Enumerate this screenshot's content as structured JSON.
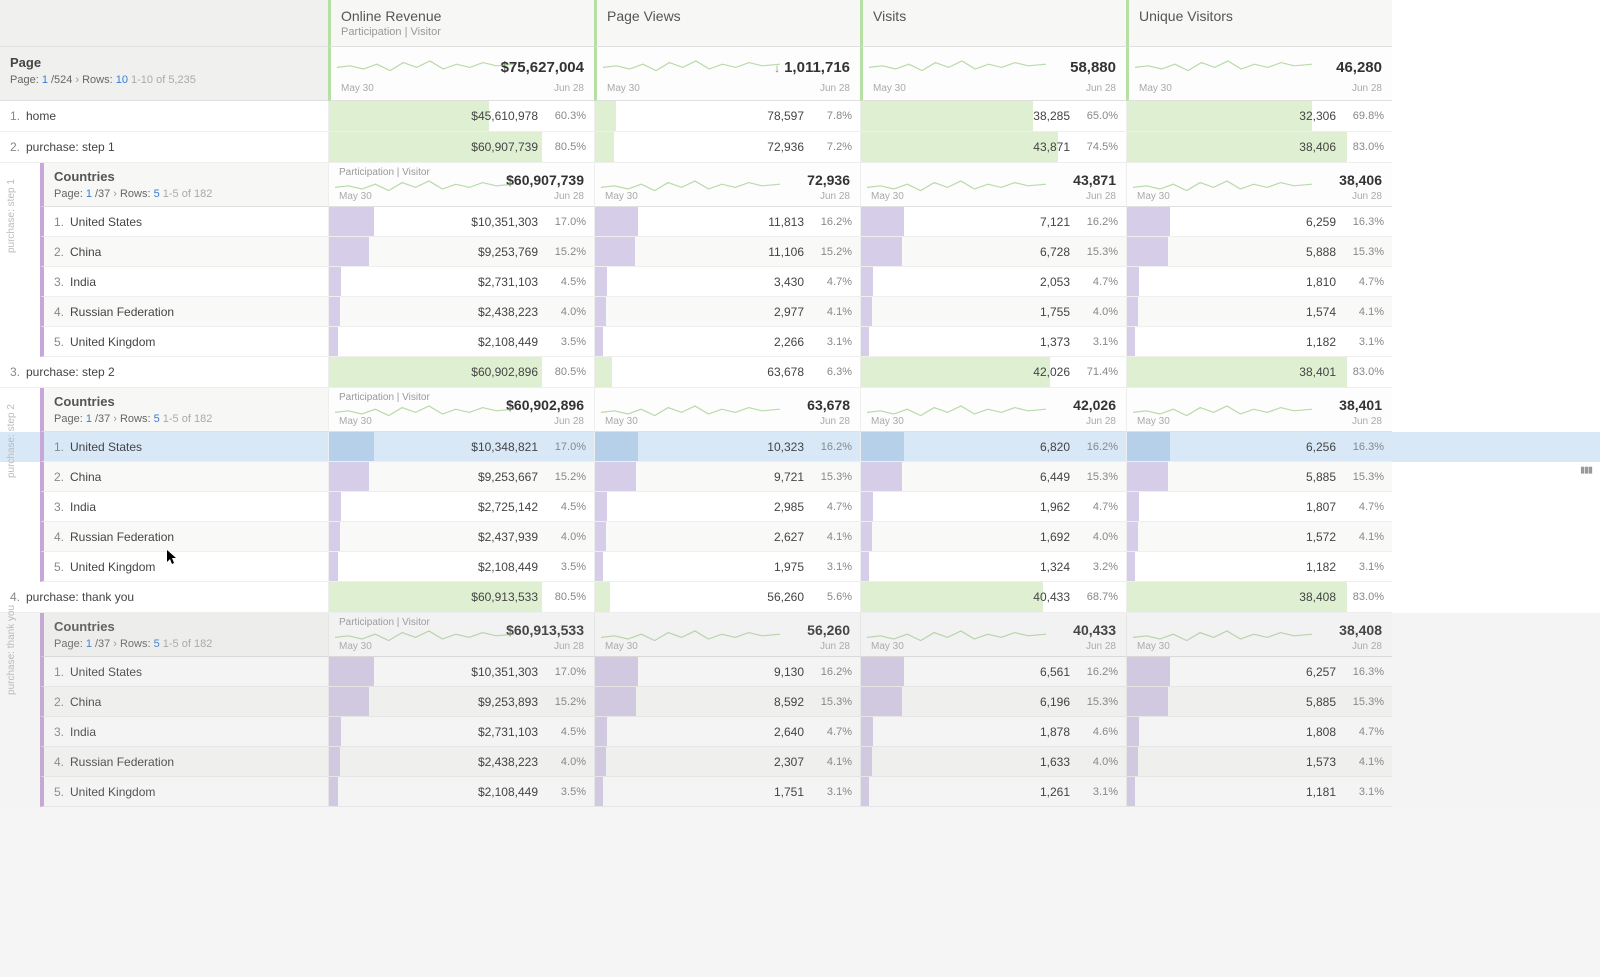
{
  "dateRange": {
    "start": "May 30",
    "end": "Jun 28"
  },
  "participationLabel": "Participation | Visitor",
  "metrics": [
    {
      "name": "Online Revenue",
      "sub": "Participation | Visitor",
      "total": "$75,627,004",
      "arrow": ""
    },
    {
      "name": "Page Views",
      "sub": "",
      "total": "1,011,716",
      "arrow": "↓"
    },
    {
      "name": "Visits",
      "sub": "",
      "total": "58,880",
      "arrow": ""
    },
    {
      "name": "Unique Visitors",
      "sub": "",
      "total": "46,280",
      "arrow": ""
    }
  ],
  "pageDim": {
    "title": "Page",
    "pager": {
      "pagePrefix": "Page:",
      "page": "1",
      "pageSep": "/524",
      "rowsPrefix": "Rows:",
      "rows": "10",
      "range": "1-10 of 5,235"
    }
  },
  "countriesDim": {
    "title": "Countries",
    "pager": {
      "pagePrefix": "Page:",
      "page": "1",
      "pageSep": "/37",
      "rowsPrefix": "Rows:",
      "rows": "5",
      "range": "1-5 of 182"
    }
  },
  "pages": [
    {
      "idx": "1.",
      "label": "home",
      "sideLabel": "",
      "cells": [
        {
          "val": "$45,610,978",
          "pct": "60.3%",
          "bar": 60.3
        },
        {
          "val": "78,597",
          "pct": "7.8%",
          "bar": 7.8
        },
        {
          "val": "38,285",
          "pct": "65.0%",
          "bar": 65.0
        },
        {
          "val": "32,306",
          "pct": "69.8%",
          "bar": 69.8
        }
      ],
      "breakdown": null
    },
    {
      "idx": "2.",
      "label": "purchase: step 1",
      "sideLabel": "purchase: step 1",
      "cells": [
        {
          "val": "$60,907,739",
          "pct": "80.5%",
          "bar": 80.5
        },
        {
          "val": "72,936",
          "pct": "7.2%",
          "bar": 7.2
        },
        {
          "val": "43,871",
          "pct": "74.5%",
          "bar": 74.5
        },
        {
          "val": "38,406",
          "pct": "83.0%",
          "bar": 83.0
        }
      ],
      "breakdown": {
        "totals": [
          "$60,907,739",
          "72,936",
          "43,871",
          "38,406"
        ],
        "rows": [
          {
            "idx": "1.",
            "label": "United States",
            "cells": [
              {
                "val": "$10,351,303",
                "pct": "17.0%",
                "bar": 17.0
              },
              {
                "val": "11,813",
                "pct": "16.2%",
                "bar": 16.2
              },
              {
                "val": "7,121",
                "pct": "16.2%",
                "bar": 16.2
              },
              {
                "val": "6,259",
                "pct": "16.3%",
                "bar": 16.3
              }
            ]
          },
          {
            "idx": "2.",
            "label": "China",
            "cells": [
              {
                "val": "$9,253,769",
                "pct": "15.2%",
                "bar": 15.2
              },
              {
                "val": "11,106",
                "pct": "15.2%",
                "bar": 15.2
              },
              {
                "val": "6,728",
                "pct": "15.3%",
                "bar": 15.3
              },
              {
                "val": "5,888",
                "pct": "15.3%",
                "bar": 15.3
              }
            ]
          },
          {
            "idx": "3.",
            "label": "India",
            "cells": [
              {
                "val": "$2,731,103",
                "pct": "4.5%",
                "bar": 4.5
              },
              {
                "val": "3,430",
                "pct": "4.7%",
                "bar": 4.7
              },
              {
                "val": "2,053",
                "pct": "4.7%",
                "bar": 4.7
              },
              {
                "val": "1,810",
                "pct": "4.7%",
                "bar": 4.7
              }
            ]
          },
          {
            "idx": "4.",
            "label": "Russian Federation",
            "cells": [
              {
                "val": "$2,438,223",
                "pct": "4.0%",
                "bar": 4.0
              },
              {
                "val": "2,977",
                "pct": "4.1%",
                "bar": 4.1
              },
              {
                "val": "1,755",
                "pct": "4.0%",
                "bar": 4.0
              },
              {
                "val": "1,574",
                "pct": "4.1%",
                "bar": 4.1
              }
            ]
          },
          {
            "idx": "5.",
            "label": "United Kingdom",
            "cells": [
              {
                "val": "$2,108,449",
                "pct": "3.5%",
                "bar": 3.5
              },
              {
                "val": "2,266",
                "pct": "3.1%",
                "bar": 3.1
              },
              {
                "val": "1,373",
                "pct": "3.1%",
                "bar": 3.1
              },
              {
                "val": "1,182",
                "pct": "3.1%",
                "bar": 3.1
              }
            ]
          }
        ]
      }
    },
    {
      "idx": "3.",
      "label": "purchase: step 2",
      "sideLabel": "purchase: step 2",
      "cells": [
        {
          "val": "$60,902,896",
          "pct": "80.5%",
          "bar": 80.5
        },
        {
          "val": "63,678",
          "pct": "6.3%",
          "bar": 6.3
        },
        {
          "val": "42,026",
          "pct": "71.4%",
          "bar": 71.4
        },
        {
          "val": "38,401",
          "pct": "83.0%",
          "bar": 83.0
        }
      ],
      "breakdown": {
        "totals": [
          "$60,902,896",
          "63,678",
          "42,026",
          "38,401"
        ],
        "highlightRow": 0,
        "rows": [
          {
            "idx": "1.",
            "label": "United States",
            "cells": [
              {
                "val": "$10,348,821",
                "pct": "17.0%",
                "bar": 17.0
              },
              {
                "val": "10,323",
                "pct": "16.2%",
                "bar": 16.2
              },
              {
                "val": "6,820",
                "pct": "16.2%",
                "bar": 16.2
              },
              {
                "val": "6,256",
                "pct": "16.3%",
                "bar": 16.3
              }
            ]
          },
          {
            "idx": "2.",
            "label": "China",
            "cells": [
              {
                "val": "$9,253,667",
                "pct": "15.2%",
                "bar": 15.2
              },
              {
                "val": "9,721",
                "pct": "15.3%",
                "bar": 15.3
              },
              {
                "val": "6,449",
                "pct": "15.3%",
                "bar": 15.3
              },
              {
                "val": "5,885",
                "pct": "15.3%",
                "bar": 15.3
              }
            ]
          },
          {
            "idx": "3.",
            "label": "India",
            "cells": [
              {
                "val": "$2,725,142",
                "pct": "4.5%",
                "bar": 4.5
              },
              {
                "val": "2,985",
                "pct": "4.7%",
                "bar": 4.7
              },
              {
                "val": "1,962",
                "pct": "4.7%",
                "bar": 4.7
              },
              {
                "val": "1,807",
                "pct": "4.7%",
                "bar": 4.7
              }
            ]
          },
          {
            "idx": "4.",
            "label": "Russian Federation",
            "cells": [
              {
                "val": "$2,437,939",
                "pct": "4.0%",
                "bar": 4.0
              },
              {
                "val": "2,627",
                "pct": "4.1%",
                "bar": 4.1
              },
              {
                "val": "1,692",
                "pct": "4.0%",
                "bar": 4.0
              },
              {
                "val": "1,572",
                "pct": "4.1%",
                "bar": 4.1
              }
            ]
          },
          {
            "idx": "5.",
            "label": "United Kingdom",
            "cells": [
              {
                "val": "$2,108,449",
                "pct": "3.5%",
                "bar": 3.5
              },
              {
                "val": "1,975",
                "pct": "3.1%",
                "bar": 3.1
              },
              {
                "val": "1,324",
                "pct": "3.2%",
                "bar": 3.2
              },
              {
                "val": "1,182",
                "pct": "3.1%",
                "bar": 3.1
              }
            ]
          }
        ]
      }
    },
    {
      "idx": "4.",
      "label": "purchase: thank you",
      "sideLabel": "purchase: thank you",
      "cells": [
        {
          "val": "$60,913,533",
          "pct": "80.5%",
          "bar": 80.5
        },
        {
          "val": "56,260",
          "pct": "5.6%",
          "bar": 5.6
        },
        {
          "val": "40,433",
          "pct": "68.7%",
          "bar": 68.7
        },
        {
          "val": "38,408",
          "pct": "83.0%",
          "bar": 83.0
        }
      ],
      "dimmed": true,
      "breakdown": {
        "totals": [
          "$60,913,533",
          "56,260",
          "40,433",
          "38,408"
        ],
        "rows": [
          {
            "idx": "1.",
            "label": "United States",
            "cells": [
              {
                "val": "$10,351,303",
                "pct": "17.0%",
                "bar": 17.0
              },
              {
                "val": "9,130",
                "pct": "16.2%",
                "bar": 16.2
              },
              {
                "val": "6,561",
                "pct": "16.2%",
                "bar": 16.2
              },
              {
                "val": "6,257",
                "pct": "16.3%",
                "bar": 16.3
              }
            ]
          },
          {
            "idx": "2.",
            "label": "China",
            "cells": [
              {
                "val": "$9,253,893",
                "pct": "15.2%",
                "bar": 15.2
              },
              {
                "val": "8,592",
                "pct": "15.3%",
                "bar": 15.3
              },
              {
                "val": "6,196",
                "pct": "15.3%",
                "bar": 15.3
              },
              {
                "val": "5,885",
                "pct": "15.3%",
                "bar": 15.3
              }
            ]
          },
          {
            "idx": "3.",
            "label": "India",
            "cells": [
              {
                "val": "$2,731,103",
                "pct": "4.5%",
                "bar": 4.5
              },
              {
                "val": "2,640",
                "pct": "4.7%",
                "bar": 4.7
              },
              {
                "val": "1,878",
                "pct": "4.6%",
                "bar": 4.6
              },
              {
                "val": "1,808",
                "pct": "4.7%",
                "bar": 4.7
              }
            ]
          },
          {
            "idx": "4.",
            "label": "Russian Federation",
            "cells": [
              {
                "val": "$2,438,223",
                "pct": "4.0%",
                "bar": 4.0
              },
              {
                "val": "2,307",
                "pct": "4.1%",
                "bar": 4.1
              },
              {
                "val": "1,633",
                "pct": "4.0%",
                "bar": 4.0
              },
              {
                "val": "1,573",
                "pct": "4.1%",
                "bar": 4.1
              }
            ]
          },
          {
            "idx": "5.",
            "label": "United Kingdom",
            "cells": [
              {
                "val": "$2,108,449",
                "pct": "3.5%",
                "bar": 3.5
              },
              {
                "val": "1,751",
                "pct": "3.1%",
                "bar": 3.1
              },
              {
                "val": "1,261",
                "pct": "3.1%",
                "bar": 3.1
              },
              {
                "val": "1,181",
                "pct": "3.1%",
                "bar": 3.1
              }
            ]
          }
        ]
      }
    }
  ],
  "chart_data": {
    "type": "table",
    "dimension": "Page",
    "date_range": [
      "May 30",
      "Jun 28"
    ],
    "metrics": [
      "Online Revenue (Participation | Visitor)",
      "Page Views",
      "Visits",
      "Unique Visitors"
    ],
    "totals": {
      "Online Revenue": 75627004,
      "Page Views": 1011716,
      "Visits": 58880,
      "Unique Visitors": 46280
    },
    "rows": [
      {
        "page": "home",
        "Online Revenue": 45610978,
        "Page Views": 78597,
        "Visits": 38285,
        "Unique Visitors": 32306,
        "pct": {
          "Online Revenue": 60.3,
          "Page Views": 7.8,
          "Visits": 65.0,
          "Unique Visitors": 69.8
        }
      },
      {
        "page": "purchase: step 1",
        "Online Revenue": 60907739,
        "Page Views": 72936,
        "Visits": 43871,
        "Unique Visitors": 38406,
        "pct": {
          "Online Revenue": 80.5,
          "Page Views": 7.2,
          "Visits": 74.5,
          "Unique Visitors": 83.0
        },
        "breakdown_dimension": "Countries",
        "breakdown": [
          {
            "country": "United States",
            "Online Revenue": 10351303,
            "Page Views": 11813,
            "Visits": 7121,
            "Unique Visitors": 6259
          },
          {
            "country": "China",
            "Online Revenue": 9253769,
            "Page Views": 11106,
            "Visits": 6728,
            "Unique Visitors": 5888
          },
          {
            "country": "India",
            "Online Revenue": 2731103,
            "Page Views": 3430,
            "Visits": 2053,
            "Unique Visitors": 1810
          },
          {
            "country": "Russian Federation",
            "Online Revenue": 2438223,
            "Page Views": 2977,
            "Visits": 1755,
            "Unique Visitors": 1574
          },
          {
            "country": "United Kingdom",
            "Online Revenue": 2108449,
            "Page Views": 2266,
            "Visits": 1373,
            "Unique Visitors": 1182
          }
        ]
      },
      {
        "page": "purchase: step 2",
        "Online Revenue": 60902896,
        "Page Views": 63678,
        "Visits": 42026,
        "Unique Visitors": 38401,
        "pct": {
          "Online Revenue": 80.5,
          "Page Views": 6.3,
          "Visits": 71.4,
          "Unique Visitors": 83.0
        },
        "breakdown_dimension": "Countries",
        "breakdown": [
          {
            "country": "United States",
            "Online Revenue": 10348821,
            "Page Views": 10323,
            "Visits": 6820,
            "Unique Visitors": 6256
          },
          {
            "country": "China",
            "Online Revenue": 9253667,
            "Page Views": 9721,
            "Visits": 6449,
            "Unique Visitors": 5885
          },
          {
            "country": "India",
            "Online Revenue": 2725142,
            "Page Views": 2985,
            "Visits": 1962,
            "Unique Visitors": 1807
          },
          {
            "country": "Russian Federation",
            "Online Revenue": 2437939,
            "Page Views": 2627,
            "Visits": 1692,
            "Unique Visitors": 1572
          },
          {
            "country": "United Kingdom",
            "Online Revenue": 2108449,
            "Page Views": 1975,
            "Visits": 1324,
            "Unique Visitors": 1182
          }
        ]
      },
      {
        "page": "purchase: thank you",
        "Online Revenue": 60913533,
        "Page Views": 56260,
        "Visits": 40433,
        "Unique Visitors": 38408,
        "pct": {
          "Online Revenue": 80.5,
          "Page Views": 5.6,
          "Visits": 68.7,
          "Unique Visitors": 83.0
        },
        "breakdown_dimension": "Countries",
        "breakdown": [
          {
            "country": "United States",
            "Online Revenue": 10351303,
            "Page Views": 9130,
            "Visits": 6561,
            "Unique Visitors": 6257
          },
          {
            "country": "China",
            "Online Revenue": 9253893,
            "Page Views": 8592,
            "Visits": 6196,
            "Unique Visitors": 5885
          },
          {
            "country": "India",
            "Online Revenue": 2731103,
            "Page Views": 2640,
            "Visits": 1878,
            "Unique Visitors": 1808
          },
          {
            "country": "Russian Federation",
            "Online Revenue": 2438223,
            "Page Views": 2307,
            "Visits": 1633,
            "Unique Visitors": 1573
          },
          {
            "country": "United Kingdom",
            "Online Revenue": 2108449,
            "Page Views": 1751,
            "Visits": 1261,
            "Unique Visitors": 1181
          }
        ]
      }
    ]
  }
}
